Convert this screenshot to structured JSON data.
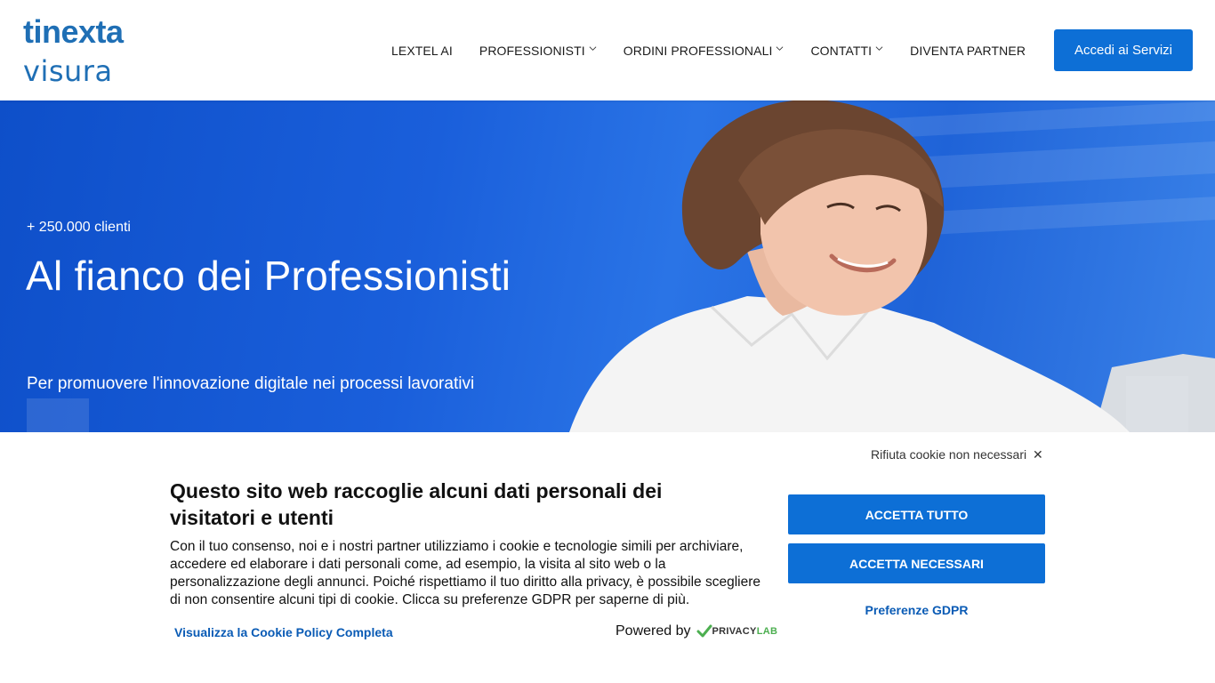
{
  "header": {
    "logo_top": "tinexta",
    "logo_bottom": "visura",
    "nav": [
      {
        "label": "LEXTEL AI",
        "has_dropdown": false
      },
      {
        "label": "PROFESSIONISTI",
        "has_dropdown": true
      },
      {
        "label": "ORDINI PROFESSIONALI",
        "has_dropdown": true
      },
      {
        "label": "CONTATTI",
        "has_dropdown": true
      },
      {
        "label": "DIVENTA PARTNER",
        "has_dropdown": false
      }
    ],
    "cta_label": "Accedi ai Servizi"
  },
  "hero": {
    "kicker": "+ 250.000 clienti",
    "title": "Al fianco dei Professionisti",
    "subtitle": "Per promuovere l'innovazione digitale nei processi lavorativi"
  },
  "cookie_banner": {
    "reject_label": "Rifiuta cookie non necessari",
    "reject_icon": "close-icon",
    "title": "Questo sito web raccoglie alcuni dati personali dei visitatori e utenti",
    "body": "Con il tuo consenso, noi e i nostri partner utilizziamo i cookie e tecnologie simili per archiviare, accedere ed elaborare i dati personali come, ad esempio, la visita al sito web o la personalizzazione degli annunci. Poiché rispettiamo il tuo diritto alla privacy, è possibile scegliere di non consentire alcuni tipi di cookie. Clicca su preferenze GDPR per saperne di più.",
    "policy_link": "Visualizza la Cookie Policy Completa",
    "powered_by": "Powered by",
    "powered_brand_a": "PRIVACY",
    "powered_brand_b": "LAB",
    "accept_all": "ACCETTA TUTTO",
    "accept_necessary": "ACCETTA NECESSARI",
    "gdpr_prefs": "Preferenze GDPR"
  },
  "colors": {
    "brand_blue": "#1f6fb5",
    "button_blue": "#0d6fd6",
    "link_blue": "#0a5bb5",
    "hero_blue": "#1a5fdb"
  }
}
